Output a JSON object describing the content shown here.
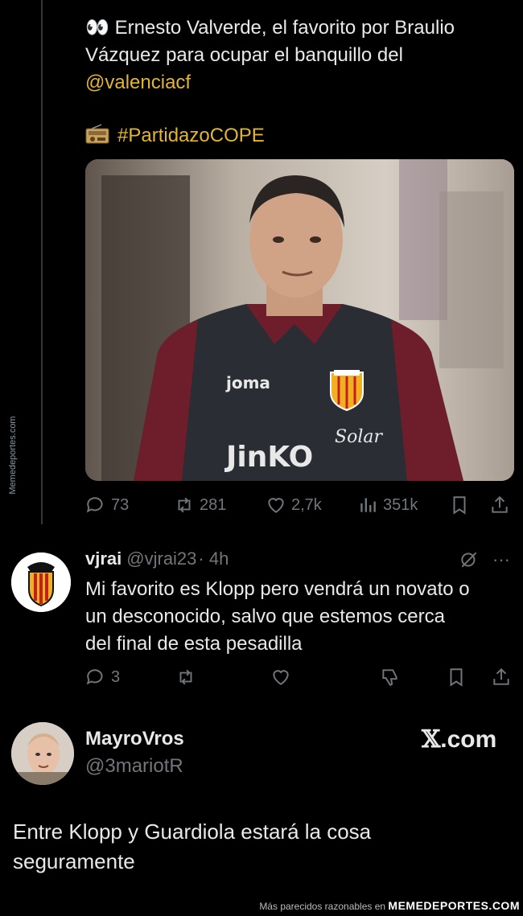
{
  "tweet": {
    "text_line1": "Ernesto Valverde, el favorito por Braulio",
    "text_line2": "Vázquez para ocupar el banquillo del",
    "mention": "@valenciacf",
    "hashtag": "#PartidazoCOPE",
    "emoji_icon": "eyes-icon",
    "hashtag_icon": "radio-icon",
    "image": {
      "jersey_brand": "joma",
      "sponsor_top": "Solar",
      "sponsor_main": "JinKO",
      "badge": "VALENCIA CF"
    },
    "stats": {
      "replies": "73",
      "retweets": "281",
      "likes": "2,7k",
      "views": "351k"
    }
  },
  "reply": {
    "name": "vjrai",
    "handle": "@vjrai23",
    "time": "· 4h",
    "text_lines": [
      "Mi favorito es Klopp pero vendrá un novato o",
      "un desconocido, salvo que estemos cerca",
      "del final de esta pesadilla"
    ],
    "stats": {
      "replies": "3"
    }
  },
  "card": {
    "name": "MayroVros",
    "handle": "@3mariotR",
    "site": ".com",
    "site_x": "𝕏",
    "text_lines": [
      "Entre Klopp y Guardiola estará la cosa",
      "seguramente"
    ]
  },
  "watermark": {
    "side": "Memedeportes.com",
    "footer_prefix": "Más parecidos razonables en",
    "footer_brand": "MEMEDEPORTES.COM"
  },
  "colors": {
    "accent_link": "#e3b531",
    "muted": "#71767b",
    "background": "#000000"
  }
}
